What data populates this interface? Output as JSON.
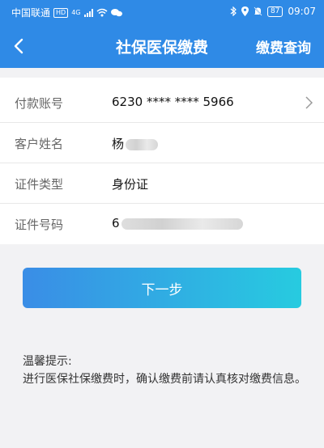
{
  "status_bar": {
    "carrier": "中国联通",
    "hd_badge": "HD",
    "network": "4G",
    "battery": "87",
    "time": "09:07"
  },
  "header": {
    "title": "社保医保缴费",
    "right_link": "缴费查询"
  },
  "form": {
    "rows": [
      {
        "label": "付款账号",
        "value": "6230 **** **** 5966"
      },
      {
        "label": "客户姓名",
        "value": "杨"
      },
      {
        "label": "证件类型",
        "value": "身份证"
      },
      {
        "label": "证件号码",
        "value": "6"
      }
    ]
  },
  "actions": {
    "next_label": "下一步"
  },
  "tips": {
    "title": "温馨提示:",
    "body": "进行医保社保缴费时，确认缴费前请认真核对缴费信息。"
  },
  "colors": {
    "primary": "#2f8ae6",
    "button_start": "#3a8de6",
    "button_end": "#27cbe0",
    "background": "#f2f2f4"
  }
}
